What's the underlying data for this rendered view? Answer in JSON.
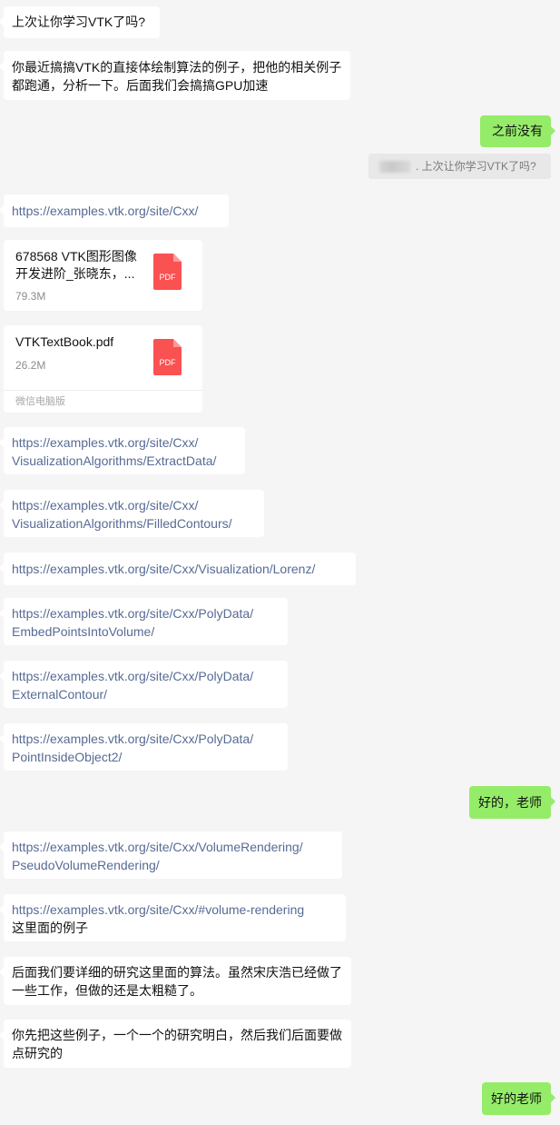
{
  "messages": {
    "m1": "上次让你学习VTK了吗?",
    "m2": [
      "你最近搞搞VTK的直接体绘制算法的例子，把他的相关例子",
      "都跑通，分析一下。后面我们会搞搞GPU加速"
    ],
    "m3": "之前没有",
    "quote": ". 上次让你学习VTK了吗?",
    "m4": "https://examples.vtk.org/site/Cxx/",
    "file1": {
      "name": [
        "678568 VTK图形图像",
        "开发进阶_张晓东，..."
      ],
      "size": "79.3M",
      "icon": "PDF"
    },
    "file2": {
      "name": [
        "VTKTextBook.pdf"
      ],
      "size": "26.2M",
      "icon": "PDF",
      "footer": "微信电脑版"
    },
    "m5": [
      "https://examples.vtk.org/site/Cxx/",
      "VisualizationAlgorithms/ExtractData/"
    ],
    "m6": [
      "https://examples.vtk.org/site/Cxx/",
      "VisualizationAlgorithms/FilledContours/"
    ],
    "m7": "https://examples.vtk.org/site/Cxx/Visualization/Lorenz/",
    "m8": [
      "https://examples.vtk.org/site/Cxx/PolyData/",
      "EmbedPointsIntoVolume/"
    ],
    "m9": [
      "https://examples.vtk.org/site/Cxx/PolyData/",
      "ExternalContour/"
    ],
    "m10": [
      "https://examples.vtk.org/site/Cxx/PolyData/",
      "PointInsideObject2/"
    ],
    "m11": "好的，老师",
    "m12": [
      "https://examples.vtk.org/site/Cxx/VolumeRendering/",
      "PseudoVolumeRendering/"
    ],
    "m13": {
      "link": "https://examples.vtk.org/site/Cxx/#volume-rendering",
      "text": "这里面的例子"
    },
    "m14": [
      "后面我们要详细的研究这里面的算法。虽然宋庆浩已经做了",
      "一些工作，但做的还是太粗糙了。"
    ],
    "m15": [
      "你先把这些例子，一个一个的研究明白，然后我们后面要做",
      "点研究的"
    ],
    "m16": "好的老师"
  },
  "colors": {
    "background": "#f5f5f5",
    "incoming_bubble": "#ffffff",
    "outgoing_bubble": "#95ec69",
    "link": "#576b95",
    "pdf_icon": "#fa5151"
  }
}
